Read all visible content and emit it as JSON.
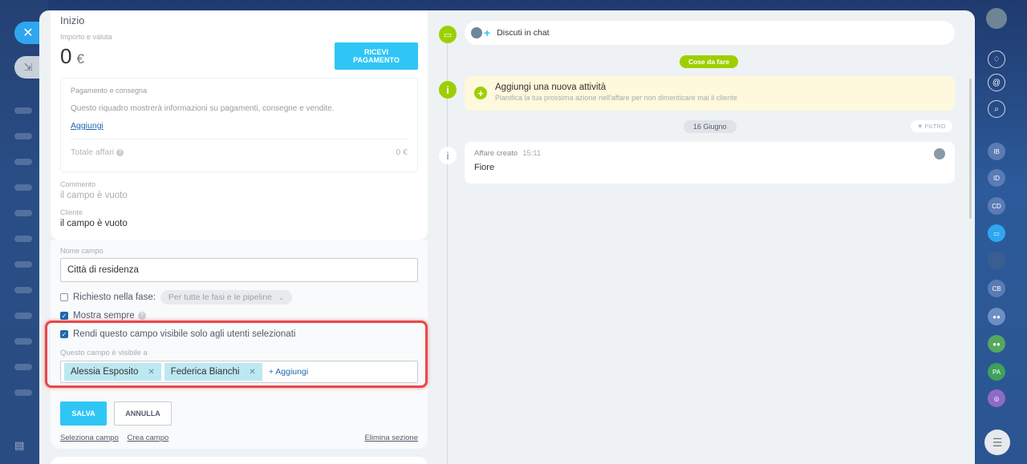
{
  "left": {
    "title": "Inizio",
    "amount_label": "Importo e valuta",
    "amount": "0",
    "currency": "€",
    "pay_button": "RICEVI PAGAMENTO",
    "payment_title": "Pagamento e consegna",
    "payment_desc": "Questo riquadro mostrerà informazioni su pagamenti, consegne e vendite.",
    "payment_add": "Aggiungi",
    "total_label": "Totale affari",
    "total_value": "0 €",
    "comment_label": "Commento",
    "comment_value": "il campo è vuoto",
    "client_label": "Cliente",
    "client_value": "il campo è vuoto"
  },
  "editor": {
    "name_label": "Nome campo",
    "name_value": "Città di residenza",
    "required_label": "Richiesto nella fase:",
    "required_checked": false,
    "stage_select": "Per tutte le fasi e le pipeline",
    "show_always_label": "Mostra sempre",
    "show_always_checked": true,
    "visible_selected_label": "Rendi questo campo visibile solo agli utenti selezionati",
    "visible_selected_checked": true,
    "visible_to_label": "Questo campo è visibile a",
    "users": [
      "Alessia Esposito",
      "Federica Bianchi"
    ],
    "add_user": "+ Aggiungi",
    "save": "SALVA",
    "cancel": "ANNULLA",
    "select_field": "Seleziona campo",
    "create_field": "Crea campo",
    "delete_section": "Elimina sezione"
  },
  "timeline": {
    "chat": "Discuti in chat",
    "todo_pill": "Cose da fare",
    "todo_title": "Aggiungi una nuova attività",
    "todo_desc": "Pianifica la tua prossima azione nell'affare per non dimenticare mai il cliente",
    "date_pill": "16 Giugno",
    "filter": "FILTRO",
    "event_title": "Affare creato",
    "event_time": "15:11",
    "event_body": "Fiore"
  },
  "sidebar": {
    "avatars": [
      "IB",
      "ID",
      "CD",
      "",
      "",
      "CB",
      "",
      "",
      "PA",
      ""
    ],
    "colors": {
      "accent": "#2fc6f6",
      "green": "#9dcf00",
      "highlight": "#e8484a"
    }
  }
}
